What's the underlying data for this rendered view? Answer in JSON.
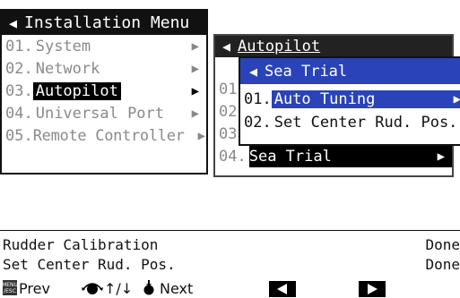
{
  "installation_menu": {
    "title": "Installation Menu",
    "items": [
      {
        "num": "01.",
        "label": "System",
        "dim": true
      },
      {
        "num": "02.",
        "label": "Network",
        "dim": true
      },
      {
        "num": "03.",
        "label": "Autopilot",
        "dim": false,
        "selected": true
      },
      {
        "num": "04.",
        "label": "Universal Port",
        "dim": true
      },
      {
        "num": "05.",
        "label": "Remote Controller",
        "dim": true
      }
    ]
  },
  "autopilot_menu": {
    "title": "Autopilot",
    "items": [
      {
        "num": "01."
      },
      {
        "num": "02."
      },
      {
        "num": "03."
      },
      {
        "num": "04.",
        "label": "Sea Trial",
        "selected": true
      }
    ]
  },
  "sea_trial_menu": {
    "title": "Sea Trial",
    "items": [
      {
        "num": "01.",
        "label": "Auto Tuning",
        "highlighted": true
      },
      {
        "num": "02.",
        "label": "Set Center Rud. Pos."
      }
    ]
  },
  "status": [
    {
      "label": "Rudder Calibration",
      "value": "Done"
    },
    {
      "label": "Set Center Rud. Pos.",
      "value": "Done"
    }
  ],
  "footer": {
    "menu_key_line1": "MENU",
    "menu_key_line2": "/ESC",
    "prev": "Prev",
    "updown": "↑/↓",
    "next": "Next"
  },
  "colors": {
    "highlight": "#2a43b8",
    "selected": "#000000"
  }
}
